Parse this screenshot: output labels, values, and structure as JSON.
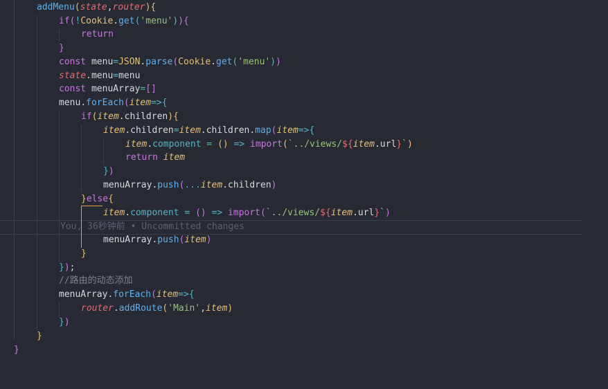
{
  "editor": {
    "lines": [
      "addMenu(state,router){",
      "if(!Cookie.get('menu')){",
      "return",
      "}",
      "const menu=JSON.parse(Cookie.get('menu'))",
      "state.menu=menu",
      "const menuArray=[]",
      "menu.forEach(item=>{",
      "if(item.children){",
      "item.children=item.children.map(item=>{",
      "item.component = () => import(`../views/${item.url}`)",
      "return item",
      "})",
      "menuArray.push(...item.children)",
      "}else{",
      "item.component = () => import(`../views/${item.url}`)",
      "menuArray.push(item)",
      "}",
      "});",
      "//路由的动态添加",
      "menuArray.forEach(item=>{",
      "router.addRoute('Main',item)",
      "})",
      "}",
      "}"
    ],
    "blame": {
      "text": "You, 36秒钟前 • Uncommitted changes"
    }
  }
}
